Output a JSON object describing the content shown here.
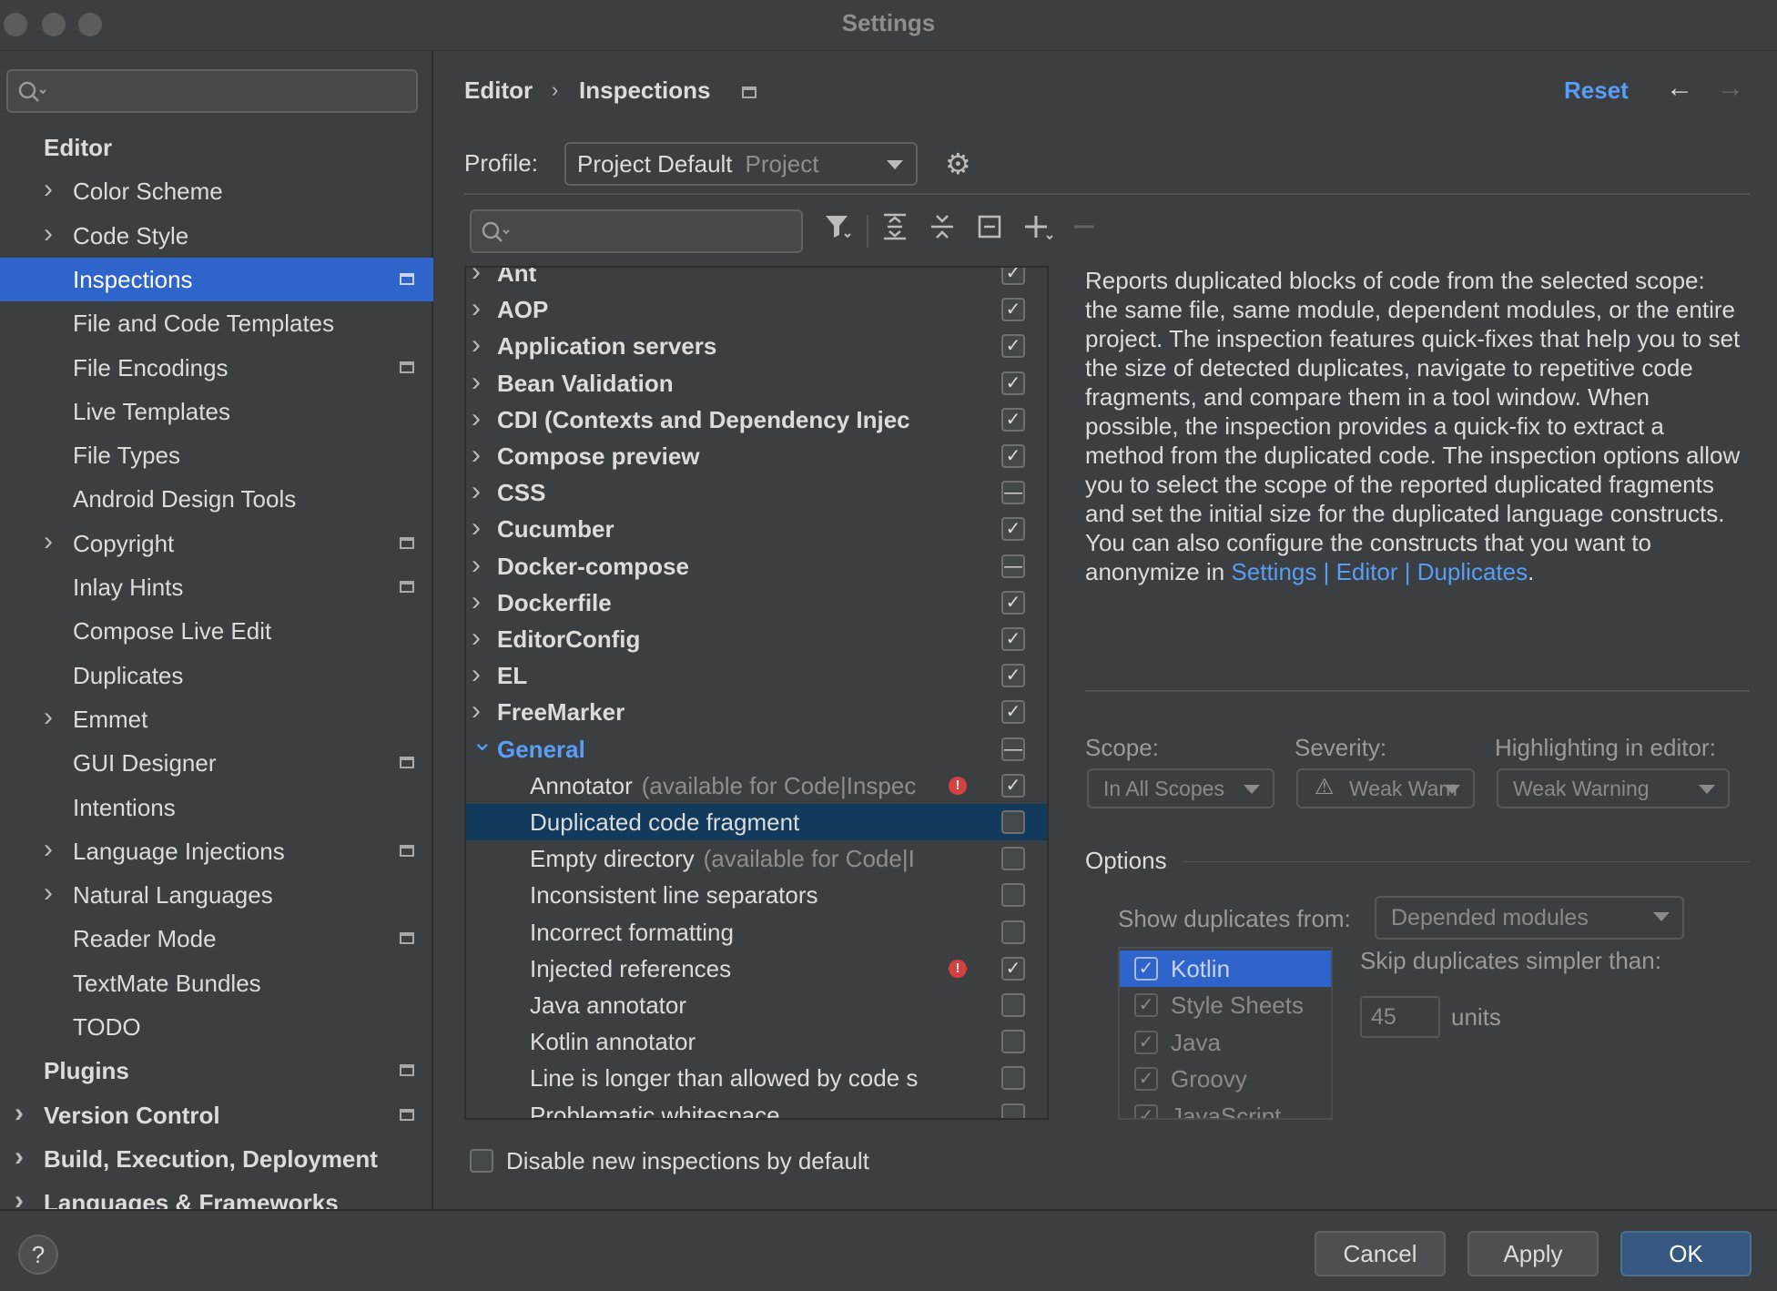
{
  "window": {
    "title": "Settings"
  },
  "sidebar": {
    "search": {
      "placeholder": ""
    },
    "items": [
      {
        "label": "Editor",
        "bold": true,
        "expandable": false,
        "pinned": false
      },
      {
        "label": "Color Scheme",
        "bold": false,
        "expandable": true,
        "pinned": false
      },
      {
        "label": "Code Style",
        "bold": false,
        "expandable": true,
        "pinned": false
      },
      {
        "label": "Inspections",
        "bold": false,
        "expandable": false,
        "pinned": true,
        "selected": true
      },
      {
        "label": "File and Code Templates",
        "bold": false,
        "expandable": false,
        "pinned": false
      },
      {
        "label": "File Encodings",
        "bold": false,
        "expandable": false,
        "pinned": true
      },
      {
        "label": "Live Templates",
        "bold": false,
        "expandable": false,
        "pinned": false
      },
      {
        "label": "File Types",
        "bold": false,
        "expandable": false,
        "pinned": false
      },
      {
        "label": "Android Design Tools",
        "bold": false,
        "expandable": false,
        "pinned": false
      },
      {
        "label": "Copyright",
        "bold": false,
        "expandable": true,
        "pinned": true
      },
      {
        "label": "Inlay Hints",
        "bold": false,
        "expandable": false,
        "pinned": true
      },
      {
        "label": "Compose Live Edit",
        "bold": false,
        "expandable": false,
        "pinned": false
      },
      {
        "label": "Duplicates",
        "bold": false,
        "expandable": false,
        "pinned": false
      },
      {
        "label": "Emmet",
        "bold": false,
        "expandable": true,
        "pinned": false
      },
      {
        "label": "GUI Designer",
        "bold": false,
        "expandable": false,
        "pinned": true
      },
      {
        "label": "Intentions",
        "bold": false,
        "expandable": false,
        "pinned": false
      },
      {
        "label": "Language Injections",
        "bold": false,
        "expandable": true,
        "pinned": true
      },
      {
        "label": "Natural Languages",
        "bold": false,
        "expandable": true,
        "pinned": false
      },
      {
        "label": "Reader Mode",
        "bold": false,
        "expandable": false,
        "pinned": true
      },
      {
        "label": "TextMate Bundles",
        "bold": false,
        "expandable": false,
        "pinned": false
      },
      {
        "label": "TODO",
        "bold": false,
        "expandable": false,
        "pinned": false
      },
      {
        "label": "Plugins",
        "bold": true,
        "expandable": false,
        "pinned": true
      },
      {
        "label": "Version Control",
        "bold": true,
        "expandable": true,
        "pinned": true
      },
      {
        "label": "Build, Execution, Deployment",
        "bold": true,
        "expandable": true,
        "pinned": false
      },
      {
        "label": "Languages & Frameworks",
        "bold": true,
        "expandable": true,
        "pinned": false
      }
    ]
  },
  "header": {
    "breadcrumb_parent": "Editor",
    "breadcrumb_sep": "›",
    "breadcrumb_current": "Inspections",
    "reset": "Reset",
    "back_glyph": "←",
    "forward_glyph": "→"
  },
  "profile": {
    "label": "Profile:",
    "value": "Project Default",
    "scope": "Project"
  },
  "tree": [
    {
      "label": "Ant",
      "level": 0,
      "bold": true,
      "state": "checked"
    },
    {
      "label": "AOP",
      "level": 0,
      "bold": true,
      "state": "checked"
    },
    {
      "label": "Application servers",
      "level": 0,
      "bold": true,
      "state": "checked"
    },
    {
      "label": "Bean Validation",
      "level": 0,
      "bold": true,
      "state": "checked"
    },
    {
      "label": "CDI (Contexts and Dependency Injec",
      "level": 0,
      "bold": true,
      "state": "checked"
    },
    {
      "label": "Compose preview",
      "level": 0,
      "bold": true,
      "state": "checked"
    },
    {
      "label": "CSS",
      "level": 0,
      "bold": true,
      "state": "mixed"
    },
    {
      "label": "Cucumber",
      "level": 0,
      "bold": true,
      "state": "checked"
    },
    {
      "label": "Docker-compose",
      "level": 0,
      "bold": true,
      "state": "mixed"
    },
    {
      "label": "Dockerfile",
      "level": 0,
      "bold": true,
      "state": "checked"
    },
    {
      "label": "EditorConfig",
      "level": 0,
      "bold": true,
      "state": "checked"
    },
    {
      "label": "EL",
      "level": 0,
      "bold": true,
      "state": "checked"
    },
    {
      "label": "FreeMarker",
      "level": 0,
      "bold": true,
      "state": "checked"
    },
    {
      "label": "General",
      "level": 0,
      "bold": true,
      "blue": true,
      "expanded": true,
      "state": "mixed"
    },
    {
      "label": "Annotator",
      "hint": "(available for Code|Inspec",
      "level": 1,
      "state": "checked",
      "error": true
    },
    {
      "label": "Duplicated code fragment",
      "level": 1,
      "state": "unchecked",
      "selected": true
    },
    {
      "label": "Empty directory",
      "hint": "(available for Code|I",
      "level": 1,
      "state": "unchecked"
    },
    {
      "label": "Inconsistent line separators",
      "level": 1,
      "state": "unchecked"
    },
    {
      "label": "Incorrect formatting",
      "level": 1,
      "state": "unchecked"
    },
    {
      "label": "Injected references",
      "level": 1,
      "state": "checked",
      "error": true
    },
    {
      "label": "Java annotator",
      "level": 1,
      "state": "unchecked"
    },
    {
      "label": "Kotlin annotator",
      "level": 1,
      "state": "unchecked"
    },
    {
      "label": "Line is longer than allowed by code s",
      "level": 1,
      "state": "unchecked"
    },
    {
      "label": "Problematic whitespace",
      "level": 1,
      "state": "unchecked"
    }
  ],
  "description": {
    "text": "Reports duplicated blocks of code from the selected scope: the same file, same module, dependent modules, or the entire project. The inspection features quick-fixes that help you to set the size of detected duplicates, navigate to repetitive code fragments, and compare them in a tool window. When possible, the inspection provides a quick-fix to extract a method from the duplicated code. The inspection options allow you to select the scope of the reported duplicated fragments and set the initial size for the duplicated language constructs. You can also configure the constructs that you want to anonymize in ",
    "link": "Settings | Editor | Duplicates",
    "end": "."
  },
  "settings": {
    "scope_label": "Scope:",
    "scope_value": "In All Scopes",
    "severity_label": "Severity:",
    "severity_value": "Weak Warn",
    "highlight_label": "Highlighting in editor:",
    "highlight_value": "Weak Warning"
  },
  "options": {
    "title": "Options",
    "show_from_label": "Show duplicates from:",
    "show_from_value": "Depended modules",
    "languages": [
      {
        "label": "Kotlin",
        "checked": true,
        "selected": true
      },
      {
        "label": "Style Sheets",
        "checked": true
      },
      {
        "label": "Java",
        "checked": true
      },
      {
        "label": "Groovy",
        "checked": true
      },
      {
        "label": "JavaScript",
        "checked": true
      }
    ],
    "skip_label": "Skip duplicates simpler than:",
    "skip_value": "45",
    "units_label": "units"
  },
  "disable_new": {
    "label": "Disable new inspections by default",
    "checked": false
  },
  "footer": {
    "help": "?",
    "cancel": "Cancel",
    "apply": "Apply",
    "ok": "OK"
  },
  "colors": {
    "accent": "#2f65ca",
    "link": "#589df6",
    "tree_selection": "#113a5c",
    "error": "#d54141"
  }
}
